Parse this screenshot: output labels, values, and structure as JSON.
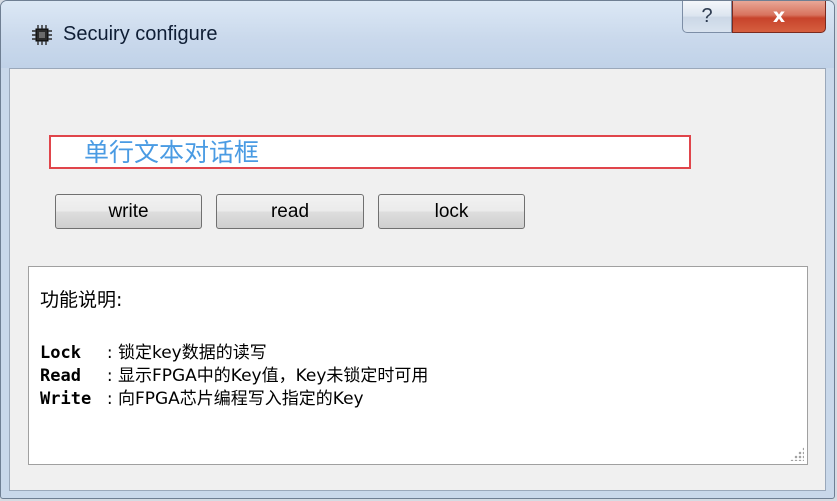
{
  "window": {
    "title": "Secuiry configure",
    "help_label": "?",
    "close_label": "x"
  },
  "input": {
    "placeholder": "单行文本对话框"
  },
  "buttons": {
    "write": "write",
    "read": "read",
    "lock": "lock"
  },
  "info": {
    "heading": "功能说明:",
    "lines": [
      {
        "key": "Lock  ",
        "desc": " : 锁定key数据的读写"
      },
      {
        "key": "Read  ",
        "desc": " : 显示FPGA中的Key值，Key未锁定时可用"
      },
      {
        "key": "Write ",
        "desc": " : 向FPGA芯片编程写入指定的Key"
      }
    ]
  },
  "colors": {
    "input_border": "#e0454b",
    "placeholder_text": "#4a9be3",
    "close_button": "#c7432b"
  },
  "icons": {
    "app": "chip-icon",
    "help": "help-icon",
    "close": "close-icon",
    "resize": "resize-grip-icon"
  }
}
